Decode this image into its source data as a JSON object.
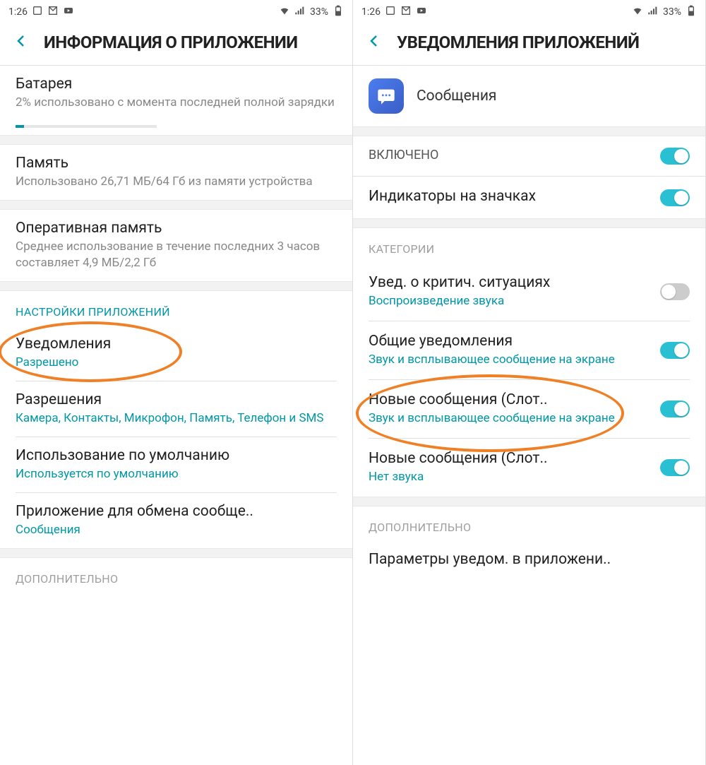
{
  "statusbar": {
    "time": "1:26",
    "battery_pct": "33%"
  },
  "screen1": {
    "title": "ИНФОРМАЦИЯ О ПРИЛОЖЕНИИ",
    "battery": {
      "title": "Батарея",
      "sub": "2% использовано с момента последней полной зарядки"
    },
    "storage": {
      "title": "Память",
      "sub": "Использовано 26,71 МБ/64 Гб из памяти устройства"
    },
    "ram": {
      "title": "Оперативная память",
      "sub": "Среднее использование в течение последних 3 часов составляет 4,9 МБ/2,2 Гб"
    },
    "section_app_settings": "НАСТРОЙКИ ПРИЛОЖЕНИЙ",
    "notifications": {
      "title": "Уведомления",
      "sub": "Разрешено"
    },
    "permissions": {
      "title": "Разрешения",
      "sub": "Камера, Контакты, Микрофон, Память, Телефон и SMS"
    },
    "default": {
      "title": "Использование по умолчанию",
      "sub": "Используется по умолчанию"
    },
    "share_app": {
      "title": "Приложение для обмена сообще..",
      "sub": "Сообщения"
    },
    "section_additional": "ДОПОЛНИТЕЛЬНО"
  },
  "screen2": {
    "title": "УВЕДОМЛЕНИЯ ПРИЛОЖЕНИЙ",
    "app_name": "Сообщения",
    "enabled": "ВКЛЮЧЕНО",
    "badges": "Индикаторы на значках",
    "section_categories": "КАТЕГОРИИ",
    "critical": {
      "title": "Увед. о критич. ситуациях",
      "sub": "Воспроизведение звука"
    },
    "general": {
      "title": "Общие уведомления",
      "sub": "Звук и всплывающее сообщение на экране"
    },
    "new_msg1": {
      "title": "Новые сообщения (Слот..",
      "sub": "Звук и всплывающее сообщение на экране"
    },
    "new_msg2": {
      "title": "Новые сообщения (Слот..",
      "sub": "Нет звука"
    },
    "section_additional": "ДОПОЛНИТЕЛЬНО",
    "notif_settings": "Параметры уведом. в приложени.."
  }
}
